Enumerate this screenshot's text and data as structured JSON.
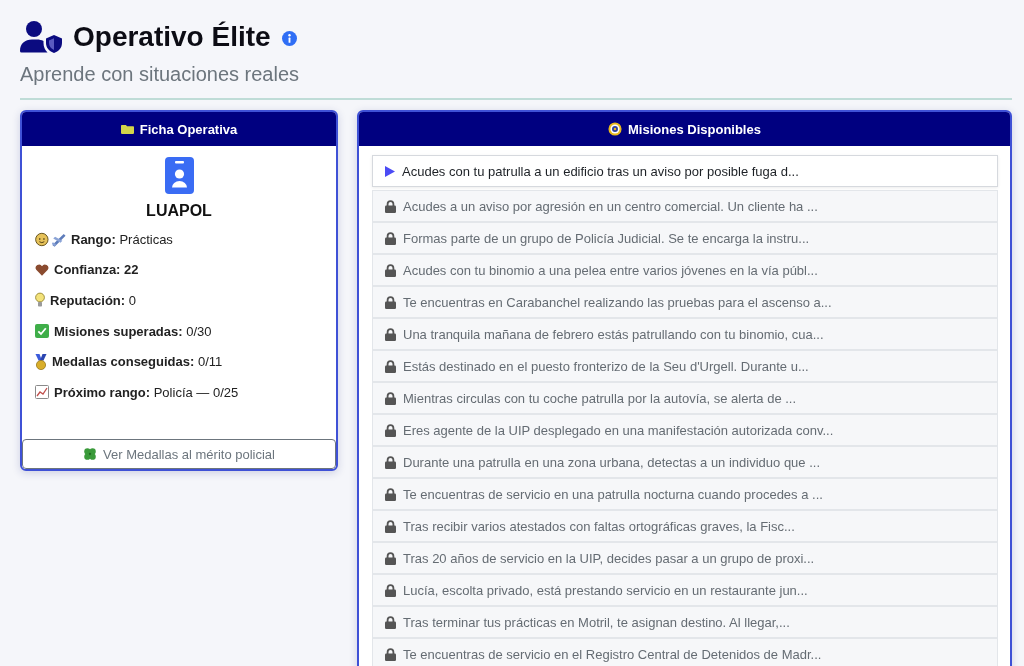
{
  "header": {
    "title": "Operativo Élite",
    "subtitle": "Aprende con situaciones reales"
  },
  "profile_card": {
    "title": "Ficha Operativa",
    "name": "LUAPOL",
    "stats": [
      {
        "kind": "rank",
        "label": "Rango:",
        "value": "Prácticas",
        "value_bold": false
      },
      {
        "kind": "trust",
        "label": "Confianza:",
        "value": "22",
        "value_bold": true
      },
      {
        "kind": "reputation",
        "label": "Reputación:",
        "value": "0",
        "value_bold": false
      },
      {
        "kind": "missions",
        "label": "Misiones superadas:",
        "value": "0/30",
        "value_bold": false
      },
      {
        "kind": "medals",
        "label": "Medallas conseguidas:",
        "value": "0/11",
        "value_bold": false
      },
      {
        "kind": "next_rank",
        "label": "Próximo rango:",
        "value": "Policía — 0/25",
        "value_bold": false
      }
    ],
    "medals_button": "Ver Medallas al mérito policial"
  },
  "missions_card": {
    "title": "Misiones Disponibles",
    "missions": [
      {
        "text": "Acudes con tu patrulla a un edificio tras un aviso por posible fuga d...",
        "locked": false
      },
      {
        "text": "Acudes a un aviso por agresión en un centro comercial. Un cliente ha ...",
        "locked": true
      },
      {
        "text": "Formas parte de un grupo de Policía Judicial. Se te encarga la instru...",
        "locked": true
      },
      {
        "text": "Acudes con tu binomio a una pelea entre varios jóvenes en la vía públ...",
        "locked": true
      },
      {
        "text": "Te encuentras en Carabanchel realizando las pruebas para el ascenso a...",
        "locked": true
      },
      {
        "text": "Una tranquila mañana de febrero estás patrullando con tu binomio, cua...",
        "locked": true
      },
      {
        "text": "Estás destinado en el puesto fronterizo de la Seu d'Urgell. Durante u...",
        "locked": true
      },
      {
        "text": "Mientras circulas con tu coche patrulla por la autovía, se alerta de ...",
        "locked": true
      },
      {
        "text": "Eres agente de la UIP desplegado en una manifestación autorizada conv...",
        "locked": true
      },
      {
        "text": "Durante una patrulla en una zona urbana, detectas a un individuo que ...",
        "locked": true
      },
      {
        "text": "Te encuentras de servicio en una patrulla nocturna cuando procedes a ...",
        "locked": true
      },
      {
        "text": "Tras recibir varios atestados con faltas ortográficas graves, la Fisc...",
        "locked": true
      },
      {
        "text": "Tras 20 años de servicio en la UIP, decides pasar a un grupo de proxi...",
        "locked": true
      },
      {
        "text": "Lucía, escolta privado, está prestando servicio en un restaurante jun...",
        "locked": true
      },
      {
        "text": "Tras terminar tus prácticas en Motril, te asignan destino. Al llegar,...",
        "locked": true
      },
      {
        "text": "Te encuentras de servicio en el Registro Central de Detenidos de Madr...",
        "locked": true
      }
    ]
  }
}
